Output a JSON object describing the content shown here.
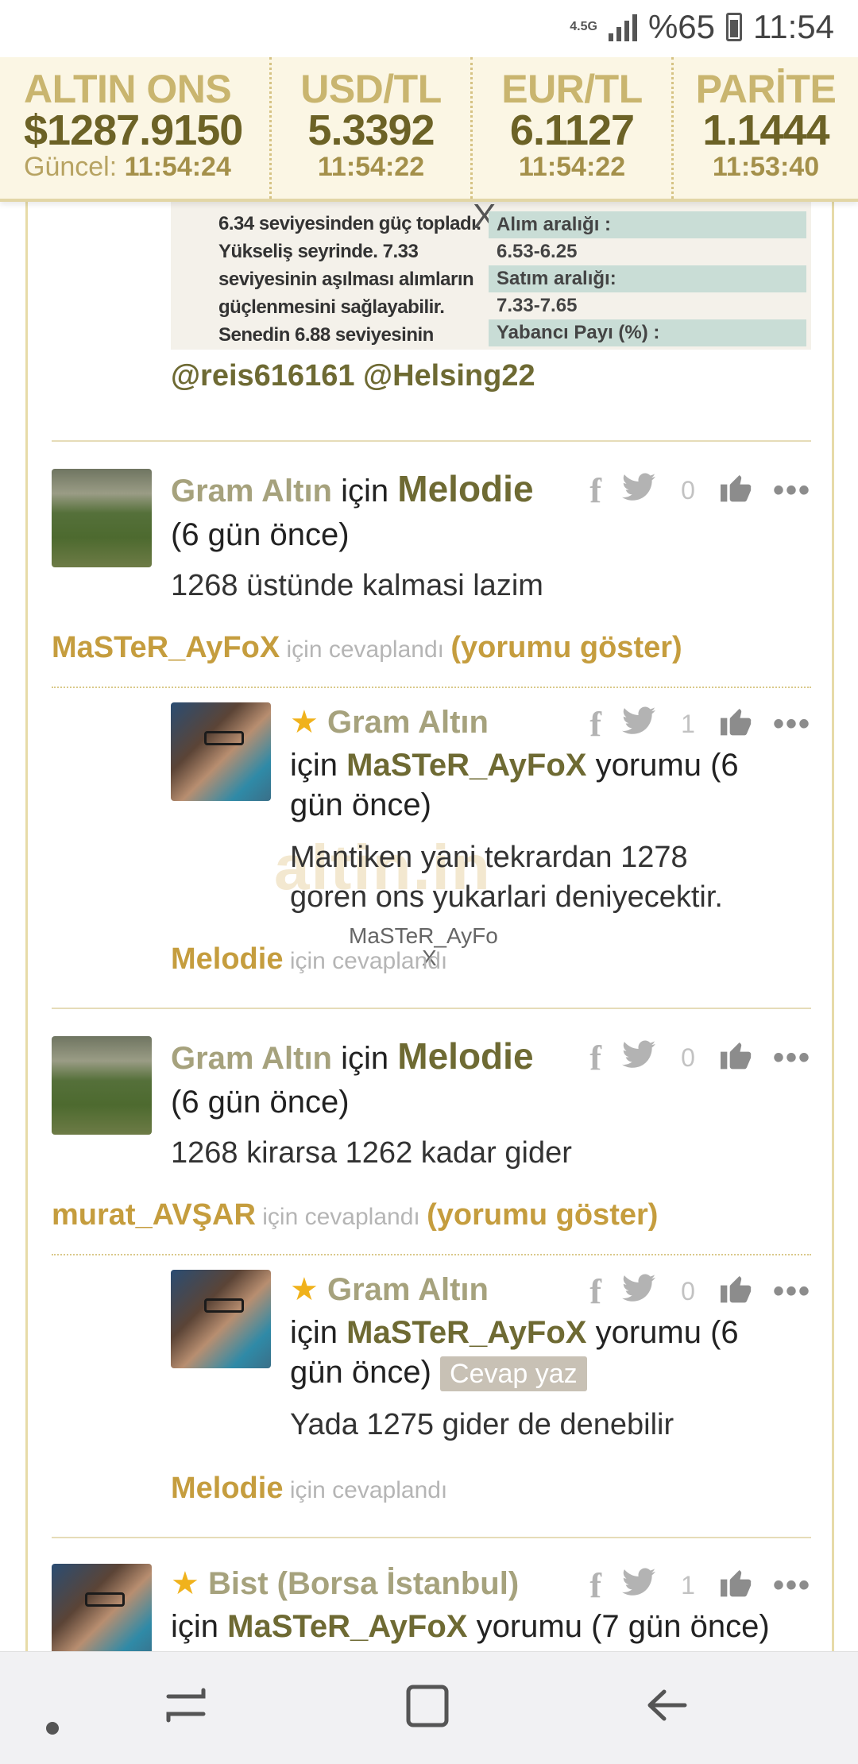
{
  "status_bar": {
    "network": "4.5G",
    "battery": "%65",
    "time": "11:54"
  },
  "ticker": [
    {
      "name": "ALTIN ONS",
      "value": "$1287.9150",
      "time_label": "Güncel:",
      "time": "11:54:24"
    },
    {
      "name": "USD/TL",
      "value": "5.3392",
      "time": "11:54:22"
    },
    {
      "name": "EUR/TL",
      "value": "6.1127",
      "time": "11:54:22"
    },
    {
      "name": "PARİTE",
      "value": "1.1444",
      "time": "11:53:40"
    }
  ],
  "image_card": {
    "left_lines": [
      "6.34 seviyesinden güç topladı.",
      "Yükseliş seyrinde. 7.33",
      "seviyesinin aşılması alımların",
      "güçlenmesini sağlayabilir.",
      "Senedin 6.88 seviyesinin"
    ],
    "rows": [
      "Alım aralığı :",
      "6.53-6.25",
      "Satım aralığı:",
      "7.33-7.65",
      "Yabancı Payı (%) :"
    ],
    "close": "X"
  },
  "mentions": "@reis616161 @Helsing22",
  "comments": [
    {
      "category": "Gram Altın",
      "for": "için",
      "user": "Melodie",
      "ago": "(6 gün önce)",
      "likes": "0",
      "text": "1268 üstünde kalmasi lazim",
      "reply_to": "MaSTeR_AyFoX",
      "replied": "için cevaplandı",
      "show": "(yorumu göster)"
    },
    {
      "category": "Gram Altın",
      "for": "için",
      "user": "MaSTeR_AyFoX",
      "suffix": "yorumu (6",
      "suffix2": "gün önce)",
      "likes": "1",
      "text1": "Mantiken yani tekrardan 1278",
      "text2": "goren ons yukarlari deniyecektir.",
      "reply_to": "Melodie",
      "replied": "için cevaplandı"
    },
    {
      "category": "Gram Altın",
      "for": "için",
      "user": "Melodie",
      "ago": "(6 gün önce)",
      "likes": "0",
      "text": "1268 kirarsa 1262 kadar gider",
      "reply_to": "murat_AVŞAR",
      "replied": "için cevaplandı",
      "show": "(yorumu göster)"
    },
    {
      "category": "Gram Altın",
      "for": "için",
      "user": "MaSTeR_AyFoX",
      "suffix": "yorumu (6",
      "suffix2": "gün önce)",
      "reply_button": "Cevap yaz",
      "likes": "0",
      "text": "Yada 1275 gider de denebilir",
      "reply_to": "Melodie",
      "replied": "için cevaplandı"
    },
    {
      "category": "Bist (Borsa İstanbul)",
      "for": "için",
      "user": "MaSTeR_AyFoX",
      "suffix": "yorumu (7 gün önce)",
      "likes": "1"
    }
  ],
  "watermark": {
    "logo": "altin.in",
    "label": "MaSTeR_AyFo",
    "close": "X"
  },
  "icons": {
    "facebook": "f",
    "more": "•••"
  },
  "colors": {
    "accent_gold": "#c59d3e",
    "ticker_value": "#6c6226",
    "username": "#6e6a33"
  }
}
